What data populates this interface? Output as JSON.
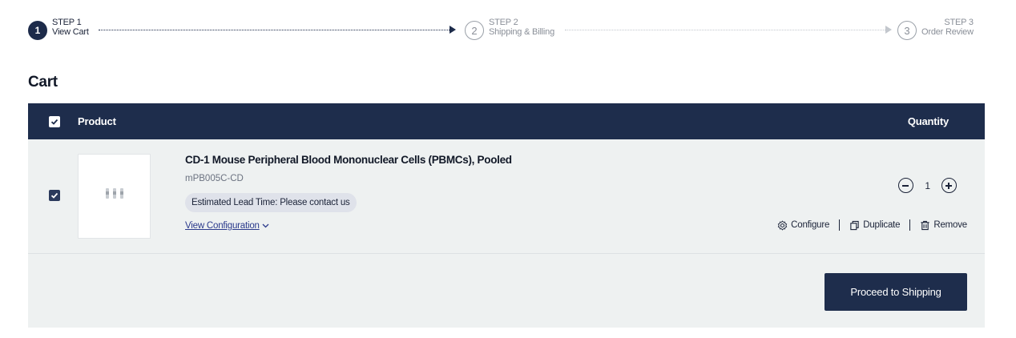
{
  "stepper": {
    "steps": [
      {
        "num": "1",
        "label": "STEP 1",
        "title": "View Cart"
      },
      {
        "num": "2",
        "label": "STEP 2",
        "title": "Shipping & Billing"
      },
      {
        "num": "3",
        "label": "STEP 3",
        "title": "Order Review"
      }
    ]
  },
  "page_title": "Cart",
  "table": {
    "header_product": "Product",
    "header_quantity": "Quantity",
    "select_all_checked": true
  },
  "item": {
    "checked": true,
    "name": "CD-1 Mouse Peripheral Blood Mononuclear Cells (PBMCs), Pooled",
    "sku": "mPB005C-CD",
    "lead_time": "Estimated Lead Time: Please contact us",
    "view_config_label": "View Configuration",
    "quantity": "1",
    "actions": {
      "configure": "Configure",
      "duplicate": "Duplicate",
      "remove": "Remove"
    }
  },
  "proceed_label": "Proceed to Shipping",
  "colors": {
    "navy": "#1e2d4c",
    "row_bg": "#eef1f1",
    "link": "#2b3a8c"
  }
}
